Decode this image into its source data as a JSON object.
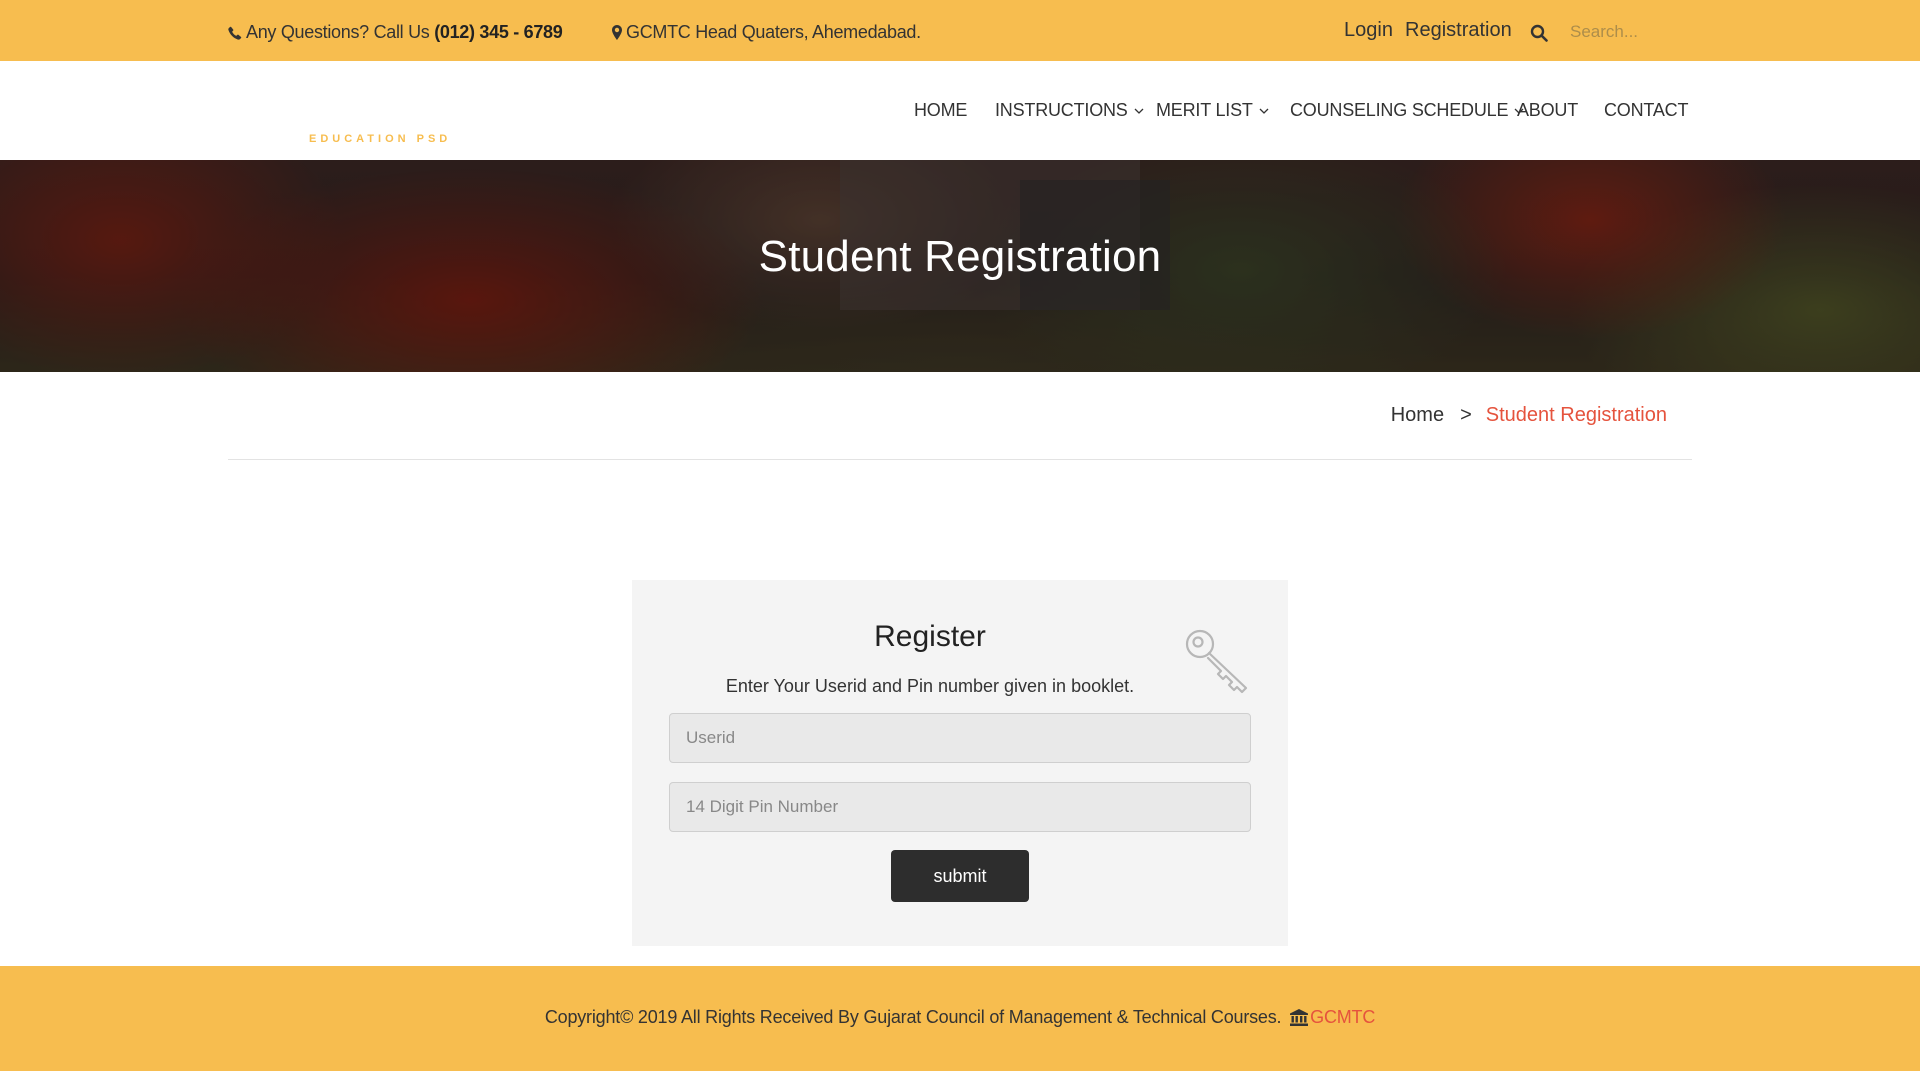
{
  "topbar": {
    "phone_prefix": "Any Questions? Call Us",
    "phone_number": "(012) 345 - 6789",
    "address": "GCMTC Head Quaters, Ahemedabad.",
    "login": "Login",
    "registration": "Registration",
    "search_placeholder": "Search..."
  },
  "brand": {
    "tagline": "EDUCATION PSD"
  },
  "nav": {
    "home": "HOME",
    "instructions": "INSTRUCTIONS",
    "merit_list": "MERIT LIST",
    "counseling_schedule": "COUNSELING SCHEDULE",
    "about": "ABOUT",
    "contact": "CONTACT"
  },
  "hero": {
    "title": "Student Registration"
  },
  "breadcrumb": {
    "home": "Home",
    "separator": ">",
    "current": "Student Registration"
  },
  "register": {
    "title": "Register",
    "description": "Enter Your Userid and Pin number given in booklet.",
    "userid_placeholder": "Userid",
    "pin_placeholder": "14 Digit Pin Number",
    "submit_label": "submit"
  },
  "footer": {
    "copyright": "Copyright© 2019 All Rights Received By Gujarat Council of Management & Technical Courses.",
    "brand": "GCMTC"
  },
  "colors": {
    "accent": "#f7bd4f",
    "highlight": "#e5533d",
    "button": "#2d2d2d"
  },
  "icons": [
    "phone-icon",
    "map-marker-icon",
    "search-icon",
    "chevron-down-icon",
    "key-icon",
    "bank-icon"
  ]
}
